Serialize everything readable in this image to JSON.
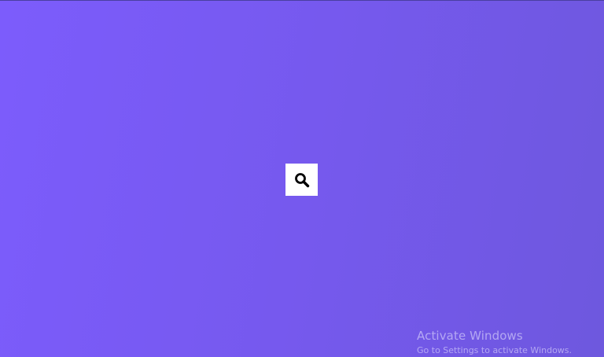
{
  "theme": {
    "background_start": "#7c5cfc",
    "background_end": "#6e58de",
    "button_background": "#ffffff",
    "icon_color": "#000000"
  },
  "search": {
    "icon": "search-icon"
  },
  "watermark": {
    "title": "Activate Windows",
    "subtitle": "Go to Settings to activate Windows."
  }
}
